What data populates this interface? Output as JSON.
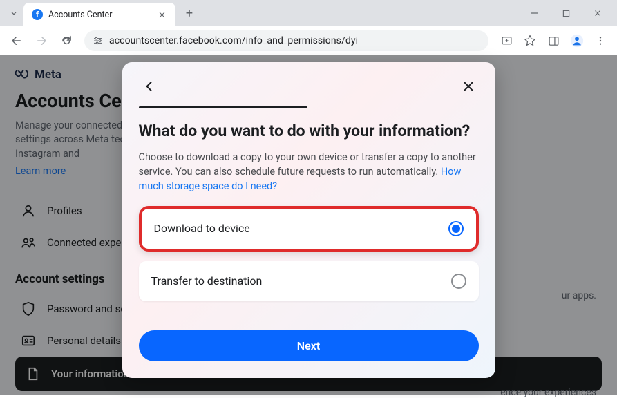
{
  "browser": {
    "tab_title": "Accounts Center",
    "url": "accountscenter.facebook.com/info_and_permissions/dyi"
  },
  "page": {
    "brand": "Meta",
    "title": "Accounts Center",
    "description": "Manage your connected experiences and account settings across Meta technologies like Facebook, Instagram and ",
    "learn_more": "Learn more",
    "sidebar": [
      {
        "label": "Profiles"
      },
      {
        "label": "Connected experiences"
      }
    ],
    "section_title": "Account settings",
    "settings": [
      {
        "label": "Password and security"
      },
      {
        "label": "Personal details"
      },
      {
        "label": "Your information and "
      }
    ],
    "side_note": "ur apps.",
    "side_note2": "ence your experiences"
  },
  "modal": {
    "title": "What do you want to do with your information?",
    "description": "Choose to download a copy to your own device or transfer a copy to another service. You can also schedule future requests to run automatically. ",
    "storage_link": "How much storage space do I need?",
    "options": [
      {
        "label": "Download to device",
        "selected": true
      },
      {
        "label": "Transfer to destination",
        "selected": false
      }
    ],
    "next_label": "Next"
  }
}
